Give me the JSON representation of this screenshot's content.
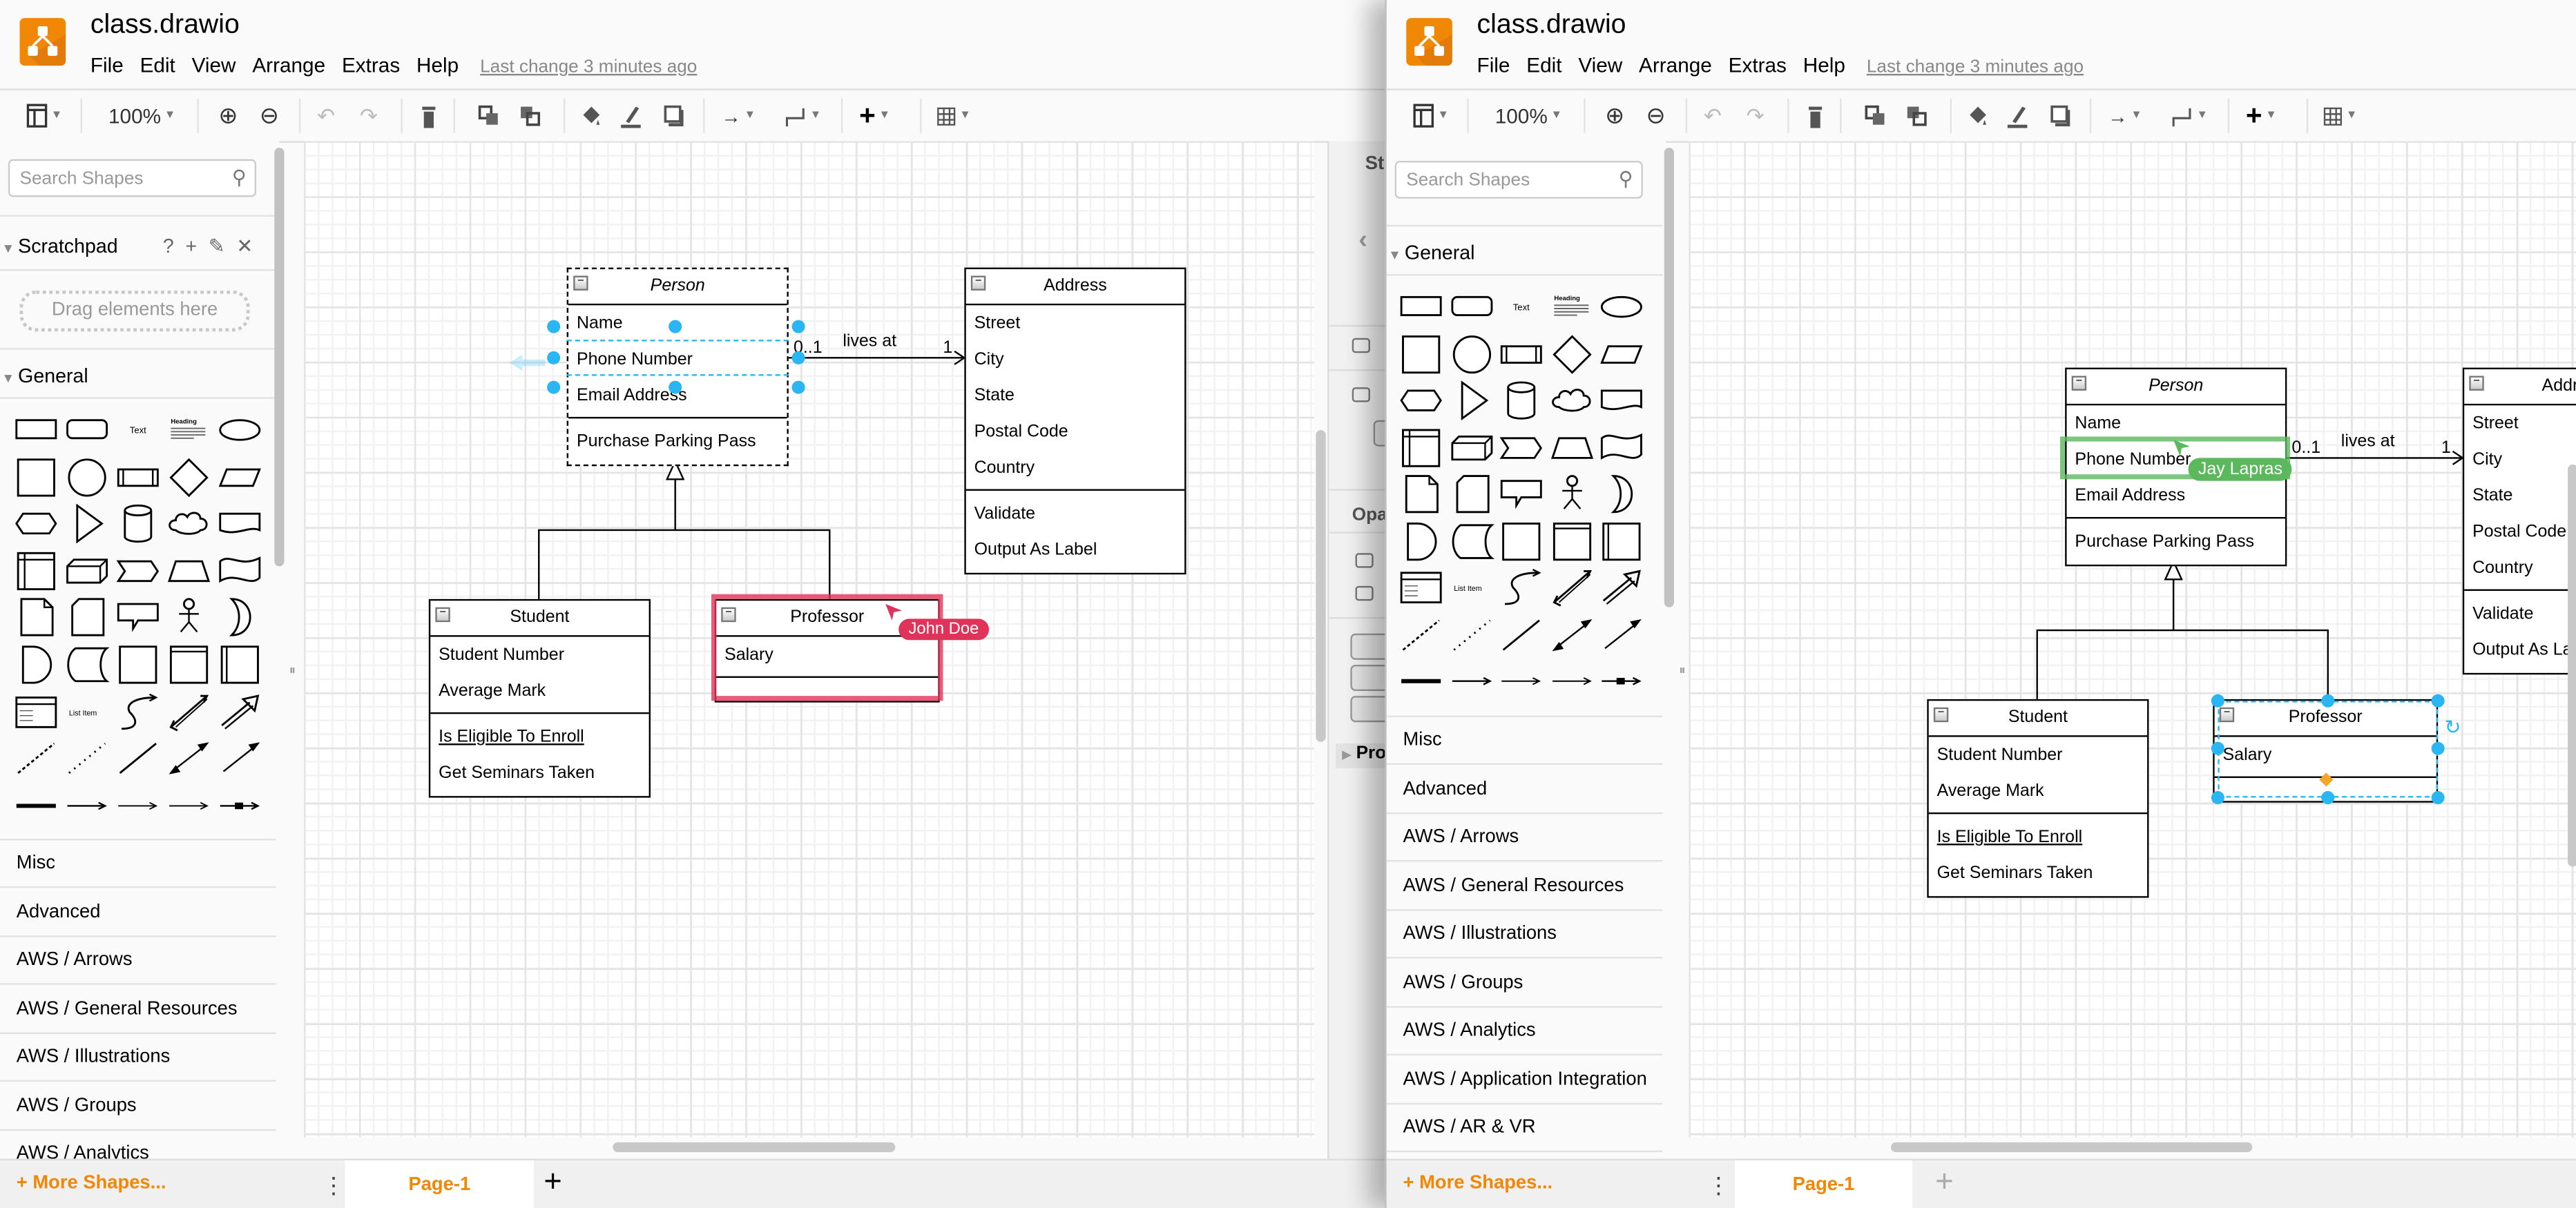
{
  "app": {
    "accent_color": "#f08705",
    "selection_color": "#29b6f2"
  },
  "left_window": {
    "title": "class.drawio",
    "menu": [
      "File",
      "Edit",
      "View",
      "Arrange",
      "Extras",
      "Help"
    ],
    "last_change": "Last change 3 minutes ago",
    "zoom": "100%",
    "search_placeholder": "Search Shapes",
    "scratchpad": {
      "title": "Scratchpad",
      "help": "?",
      "add": "+",
      "drop_hint": "Drag elements here"
    },
    "general_title": "General",
    "categories": [
      "Misc",
      "Advanced",
      "AWS / Arrows",
      "AWS / General Resources",
      "AWS / Illustrations",
      "AWS / Groups",
      "AWS / Analytics"
    ],
    "more_shapes": "+ More Shapes...",
    "page_tab": "Page-1",
    "format_panel": {
      "style_tab": "St",
      "opacity": "Opa",
      "properties": "Pro"
    },
    "collaborator": {
      "name": "John Doe",
      "color": "#e0335a"
    }
  },
  "right_window": {
    "title": "class.drawio",
    "menu": [
      "File",
      "Edit",
      "View",
      "Arrange",
      "Extras",
      "Help"
    ],
    "last_change": "Last change 3 minutes ago",
    "zoom": "100%",
    "search_placeholder": "Search Shapes",
    "general_title": "General",
    "categories": [
      "Misc",
      "Advanced",
      "AWS / Arrows",
      "AWS / General Resources",
      "AWS / Illustrations",
      "AWS / Groups",
      "AWS / Analytics",
      "AWS / Application Integration",
      "AWS / AR & VR"
    ],
    "more_shapes": "+ More Shapes...",
    "page_tab": "Page-1",
    "collaborator": {
      "name": "Jay Lapras",
      "color": "#5cb85c"
    }
  },
  "shape_library": {
    "text_label": "Text",
    "heading_label": "Heading",
    "list_item_label": "List Item",
    "icons": [
      "rectangle",
      "rounded-rectangle",
      "text",
      "textbox",
      "ellipse",
      "square",
      "circle",
      "process",
      "diamond",
      "parallelogram",
      "hexagon",
      "triangle",
      "cylinder",
      "cloud",
      "document",
      "internal-storage",
      "cube",
      "step",
      "trapezoid",
      "tape",
      "note",
      "card",
      "callout",
      "actor",
      "or",
      "and",
      "data-storage",
      "container",
      "vertical-container",
      "horizontal-container",
      "list",
      "list-item",
      "curve",
      "bidirectional-arrow",
      "arrow",
      "dashed-line",
      "dotted-line",
      "line",
      "bidirectional-connector",
      "directional-connector",
      "link",
      "connector-with-label",
      "connector-with-2-labels",
      "connector-with-3-labels",
      "connector-with-symbol"
    ]
  },
  "diagram": {
    "classes": {
      "person": {
        "name": "Person",
        "attributes": [
          "Name",
          "Phone Number",
          "Email Address"
        ],
        "methods": [
          "Purchase Parking Pass"
        ]
      },
      "address": {
        "name": "Address",
        "attributes": [
          "Street",
          "City",
          "State",
          "Postal Code",
          "Country"
        ],
        "methods": [
          "Validate",
          "Output As Label"
        ]
      },
      "student": {
        "name": "Student",
        "attributes": [
          "Student Number",
          "Average Mark"
        ],
        "methods": [
          "Is Eligible To Enroll",
          "Get Seminars Taken"
        ]
      },
      "professor": {
        "name": "Professor",
        "attributes": [
          "Salary"
        ],
        "methods": []
      }
    },
    "association": {
      "label": "lives at",
      "source_multiplicity": "0..1",
      "target_multiplicity": "1"
    }
  }
}
